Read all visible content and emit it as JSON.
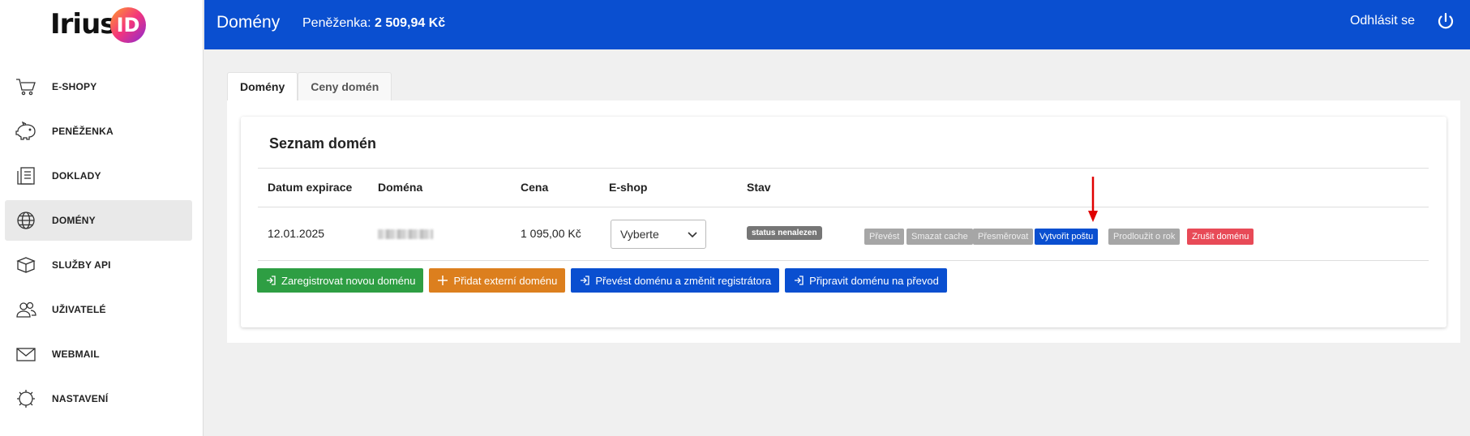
{
  "brand": {
    "logo_text": "Irius",
    "logo_badge": "ID"
  },
  "sidebar": {
    "items": [
      {
        "label": "E-SHOPY",
        "icon": "cart-icon",
        "active": false
      },
      {
        "label": "PENĚŽENKA",
        "icon": "piggy-bank-icon",
        "active": false
      },
      {
        "label": "DOKLADY",
        "icon": "documents-icon",
        "active": false
      },
      {
        "label": "DOMÉNY",
        "icon": "globe-icon",
        "active": true
      },
      {
        "label": "SLUŽBY API",
        "icon": "package-icon",
        "active": false
      },
      {
        "label": "UŽIVATELÉ",
        "icon": "users-icon",
        "active": false
      },
      {
        "label": "WEBMAIL",
        "icon": "mail-icon",
        "active": false
      },
      {
        "label": "NASTAVENÍ",
        "icon": "gear-icon",
        "active": false
      }
    ]
  },
  "header": {
    "title": "Domény",
    "wallet_label": "Peněženka:",
    "wallet_value": "2 509,94 Kč",
    "logout_label": "Odhlásit se",
    "bg_color": "#0a4fd0"
  },
  "tabs": [
    {
      "label": "Domény",
      "active": true
    },
    {
      "label": "Ceny domén",
      "active": false
    }
  ],
  "card": {
    "title": "Seznam domén",
    "columns": [
      "Datum expirace",
      "Doména",
      "Cena",
      "E-shop",
      "Stav"
    ],
    "rows": [
      {
        "expiry": "12.01.2025",
        "price": "1 095,00 Kč",
        "eshop_select": "Vyberte",
        "status": "status nenalezen",
        "actions": [
          "Převést",
          "Smazat cache",
          "Přesměrovat",
          "Vytvořit poštu",
          "Prodloužit o rok",
          "Zrušit doménu"
        ]
      }
    ],
    "buttons": [
      "Zaregistrovat novou doménu",
      "Přidat externí doménu",
      "Převést doménu a změnit registrátora",
      "Připravit doménu na převod"
    ]
  },
  "colors": {
    "green": "#2e9e43",
    "orange": "#dc7f1e",
    "blue": "#0a4fd0",
    "red": "#e84a57",
    "grey": "#a6a6a6",
    "arrow": "#e00000"
  }
}
